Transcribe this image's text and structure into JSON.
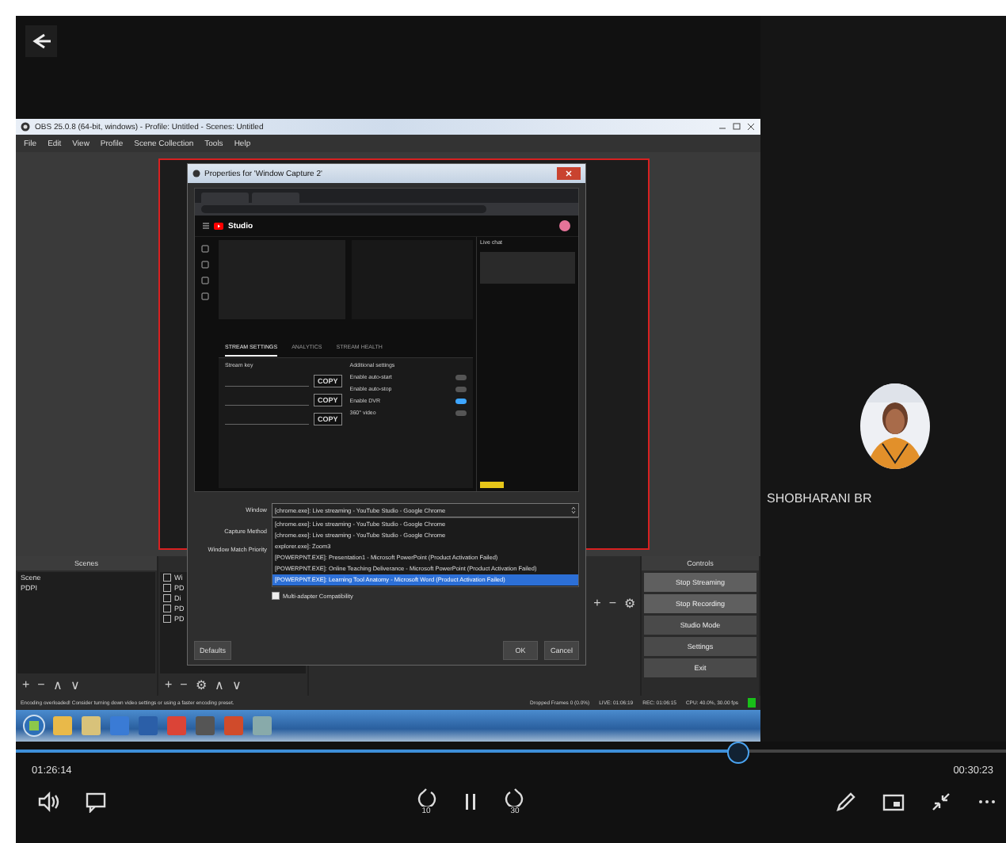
{
  "recording": {
    "window_title": "OBS 25.0.8 (64-bit, windows) - Profile: Untitled - Scenes: Untitled",
    "menu": [
      "File",
      "Edit",
      "View",
      "Profile",
      "Scene Collection",
      "Tools",
      "Help"
    ],
    "dialog": {
      "title": "Properties for 'Window Capture 2'",
      "captured_page": {
        "logo": "Studio",
        "tabs": [
          {
            "label": "STREAM SETTINGS",
            "selected": true
          },
          {
            "label": "ANALYTICS",
            "selected": false
          },
          {
            "label": "STREAM HEALTH",
            "selected": false
          }
        ],
        "stream_key_label": "Stream key",
        "copy_buttons": [
          "COPY",
          "COPY",
          "COPY"
        ],
        "settings_title": "Additional settings",
        "toggles": [
          {
            "label": "Enable auto-start",
            "on": false
          },
          {
            "label": "Enable auto-stop",
            "on": false
          },
          {
            "label": "Enable DVR",
            "on": true
          },
          {
            "label": "360° video",
            "on": false
          }
        ],
        "chat_title": "Live chat"
      },
      "fields": [
        {
          "label": "Window",
          "value": "[chrome.exe]: Live streaming - YouTube Studio - Google Chrome"
        },
        {
          "label": "Capture Method"
        },
        {
          "label": "Window Match Priority"
        }
      ],
      "options": [
        {
          "text": "[chrome.exe]: Live streaming - YouTube Studio - Google Chrome",
          "selected": false
        },
        {
          "text": "[chrome.exe]: Live streaming - YouTube Studio - Google Chrome",
          "selected": false
        },
        {
          "text": "explorer.exe]: Zoom3",
          "selected": false
        },
        {
          "text": "[POWERPNT.EXE]: Presentation1 - Microsoft PowerPoint (Product Activation Failed)",
          "selected": false
        },
        {
          "text": "[POWERPNT.EXE]: Online Teaching Deliverance - Microsoft PowerPoint (Product Activation Failed)",
          "selected": false
        },
        {
          "text": "[POWERPNT.EXE]: Learning Tool Anatomy - Microsoft Word (Product Activation Failed)",
          "selected": true
        }
      ],
      "checkbox": {
        "label": "Multi-adapter Compatibility",
        "checked": false
      },
      "buttons": [
        "Defaults",
        "OK",
        "Cancel"
      ]
    },
    "scenes": {
      "title": "Scenes",
      "items": [
        "Scene",
        "PDPI"
      ],
      "toolbar": [
        "+",
        "−",
        "∧",
        "∨"
      ]
    },
    "sources": {
      "items": [
        {
          "label": "Wi",
          "checked": false
        },
        {
          "label": "PD",
          "checked": false
        },
        {
          "label": "Di",
          "checked": false
        },
        {
          "label": "PD",
          "checked": false
        },
        {
          "label": "PD",
          "checked": false
        }
      ],
      "toolbar": [
        "+",
        "−",
        "⚙",
        "∧",
        "∨"
      ]
    },
    "mixer": {
      "toolbar": [
        "+",
        "−",
        "⚙"
      ]
    },
    "controls": {
      "title": "Controls",
      "buttons": [
        "Stop Streaming",
        "Stop Recording",
        "Studio Mode",
        "Settings",
        "Exit"
      ]
    },
    "status": {
      "message": "Encoding overloaded! Consider turning down video settings or using a faster encoding preset.",
      "dropped": "Dropped Frames 0 (0.0%)",
      "live": "LIVE: 01:06:19",
      "rec": "REC: 01:06:15",
      "cpu": "CPU: 40.0%, 30.00 fps"
    }
  },
  "participant": {
    "name": "SHOBHARANI BR"
  },
  "playback": {
    "level": 0.73,
    "elapsed": "01:26:14",
    "remaining": "00:30:23",
    "skip_back": "10",
    "skip_forward": "30"
  }
}
